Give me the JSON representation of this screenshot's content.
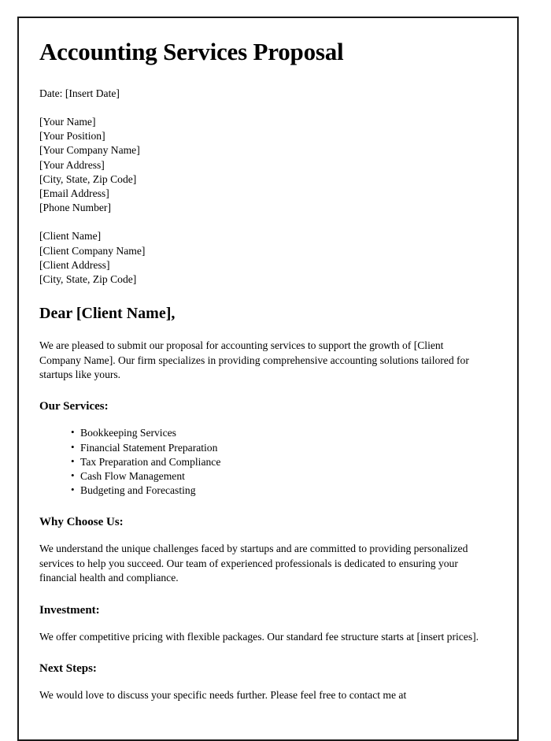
{
  "document": {
    "title": "Accounting Services Proposal",
    "date_line": "Date: [Insert Date]",
    "sender_block": [
      "[Your Name]",
      "[Your Position]",
      "[Your Company Name]",
      "[Your Address]",
      "[City, State, Zip Code]",
      "[Email Address]",
      "[Phone Number]"
    ],
    "recipient_block": [
      "[Client Name]",
      "[Client Company Name]",
      "[Client Address]",
      "[City, State, Zip Code]"
    ],
    "salutation": "Dear [Client Name],",
    "intro_paragraph": "We are pleased to submit our proposal for accounting services to support the growth of [Client Company Name]. Our firm specializes in providing comprehensive accounting solutions tailored for startups like yours.",
    "sections": [
      {
        "heading": "Our Services:",
        "items": [
          "Bookkeeping Services",
          "Financial Statement Preparation",
          "Tax Preparation and Compliance",
          "Cash Flow Management",
          "Budgeting and Forecasting"
        ]
      },
      {
        "heading": "Why Choose Us:",
        "paragraph": "We understand the unique challenges faced by startups and are committed to providing personalized services to help you succeed. Our team of experienced professionals is dedicated to ensuring your financial health and compliance."
      },
      {
        "heading": "Investment:",
        "paragraph": "We offer competitive pricing with flexible packages. Our standard fee structure starts at [insert prices]."
      },
      {
        "heading": "Next Steps:",
        "paragraph": "We would love to discuss your specific needs further. Please feel free to contact me at"
      }
    ]
  }
}
